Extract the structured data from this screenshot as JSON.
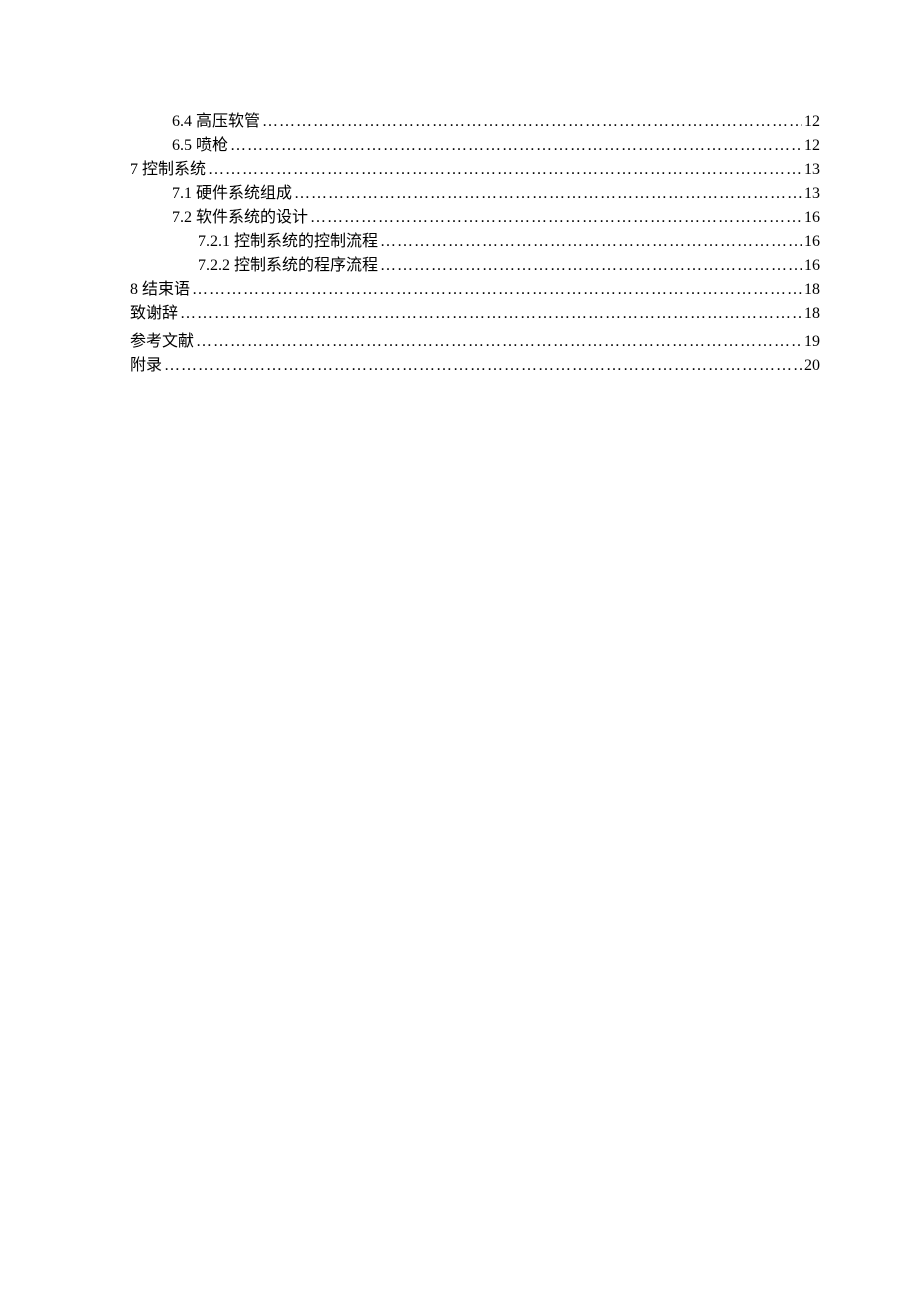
{
  "toc": [
    {
      "indent": 1,
      "label": "6.4  高压软管",
      "page": "12"
    },
    {
      "indent": 1,
      "label": "6.5  喷枪",
      "page": "12"
    },
    {
      "indent": 0,
      "label": "7  控制系统",
      "page": "13"
    },
    {
      "indent": 1,
      "label": "7.1  硬件系统组成",
      "page": "13"
    },
    {
      "indent": 1,
      "label": "7.2  软件系统的设计",
      "page": "16"
    },
    {
      "indent": 2,
      "label": "7.2.1  控制系统的控制流程",
      "page": "16"
    },
    {
      "indent": 2,
      "label": "7.2.2  控制系统的程序流程",
      "page": "16"
    },
    {
      "indent": 0,
      "label": "8  结束语",
      "page": "18"
    },
    {
      "indent": 0,
      "label": "致谢辞 ",
      "page": "18"
    },
    {
      "spacer": true
    },
    {
      "indent": 0,
      "label": "参考文献 ",
      "page": "19"
    },
    {
      "indent": 0,
      "label": "附录 ",
      "page": "20"
    }
  ]
}
